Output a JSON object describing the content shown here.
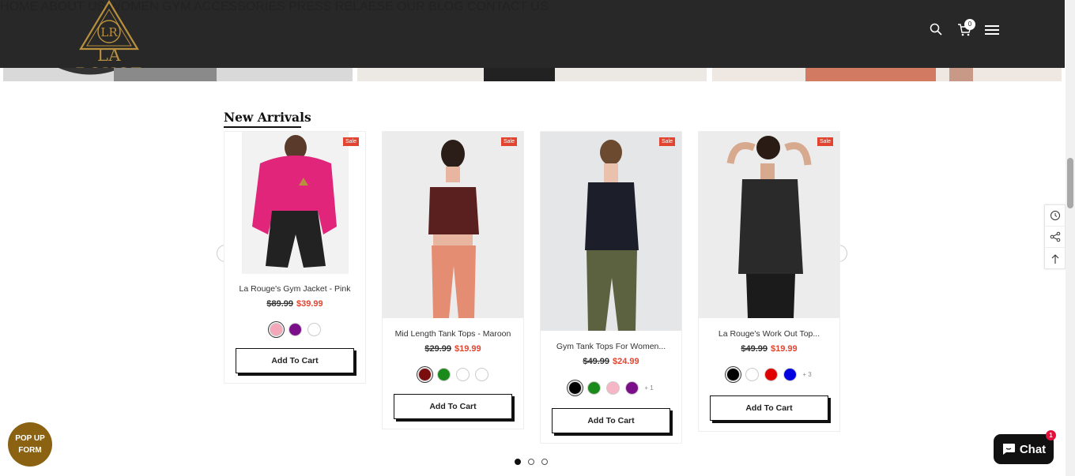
{
  "header": {
    "logo_text": "LA ROUGE",
    "logo_monogram": "LR",
    "nav": [
      {
        "label": "HOME",
        "name": "nav-home"
      },
      {
        "label": "ABOUT US",
        "name": "nav-about-us"
      },
      {
        "label": "WOMEN",
        "name": "nav-women"
      },
      {
        "label": "GYM ACCESSORIES",
        "name": "nav-gym-accessories"
      },
      {
        "label": "PRESS RELAESE",
        "name": "nav-press-release"
      },
      {
        "label": "OUR BLOG",
        "name": "nav-our-blog"
      },
      {
        "label": "CONTACT US",
        "name": "nav-contact-us"
      }
    ],
    "cart_count": "0",
    "icons": [
      "search-icon",
      "cart-icon",
      "menu-icon"
    ]
  },
  "section": {
    "title": "New Arrivals"
  },
  "products": [
    {
      "name": "La Rouge's Gym Jacket - Pink",
      "old_price": "$89.99",
      "new_price": "$39.99",
      "sale": "Sale",
      "add_to_cart": "Add To Cart",
      "swatches": [
        "#f4a7b9",
        "#7b0f8a",
        "#ffffff"
      ],
      "more": ""
    },
    {
      "name": "Mid Length Tank Tops - Maroon",
      "old_price": "$29.99",
      "new_price": "$19.99",
      "sale": "Sale",
      "add_to_cart": "Add To Cart",
      "swatches": [
        "#7a0d0d",
        "#1a8a1a",
        "#ffffff",
        "#ffffff"
      ],
      "more": ""
    },
    {
      "name": "Gym Tank Tops For Women...",
      "old_price": "$49.99",
      "new_price": "$24.99",
      "sale": "Sale",
      "add_to_cart": "Add To Cart",
      "swatches": [
        "#000000",
        "#1a8a1a",
        "#f7b6c6",
        "#7b0f8a"
      ],
      "more": "+ 1"
    },
    {
      "name": "La Rouge's Work Out Top...",
      "old_price": "$49.99",
      "new_price": "$19.99",
      "sale": "Sale",
      "add_to_cart": "Add To Cart",
      "swatches": [
        "#000000",
        "#ffffff",
        "#e00000",
        "#0000e0"
      ],
      "more": "+ 3"
    }
  ],
  "carousel": {
    "prev": "‹",
    "next": "›",
    "dots": 3,
    "active_dot": 0
  },
  "popup": {
    "label": "POP UP FORM"
  },
  "chat": {
    "label": "Chat",
    "badge": "1"
  },
  "colors": {
    "header_bg": "#282828",
    "sale_red": "#e3442f",
    "gold": "#b8903e"
  }
}
